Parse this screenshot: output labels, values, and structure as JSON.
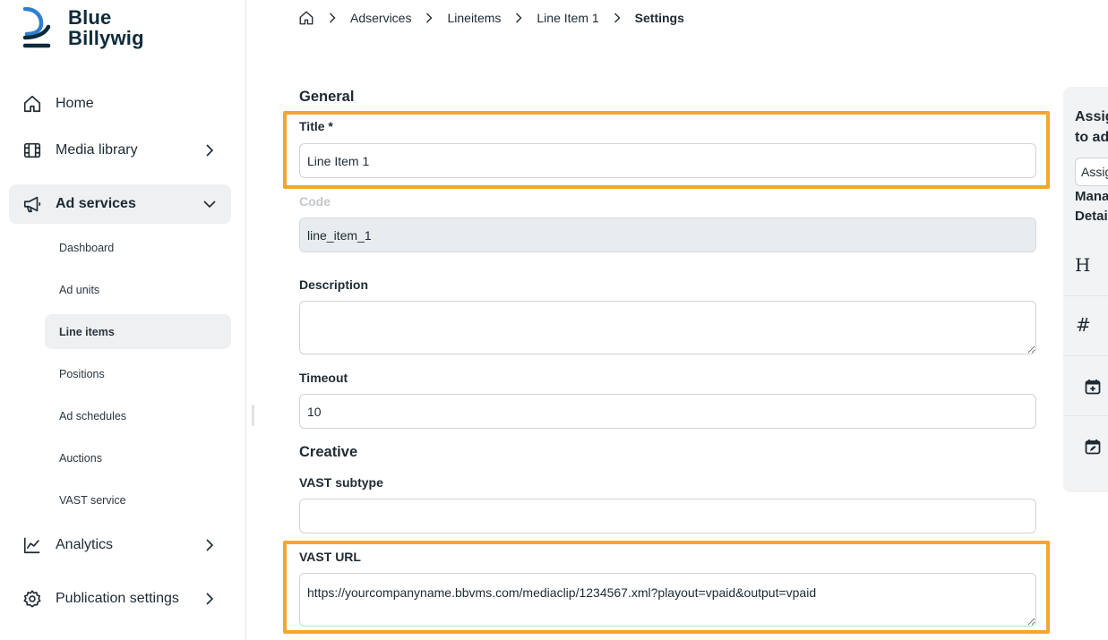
{
  "brand": {
    "line1": "Blue",
    "line2": "Billywig",
    "accent": "#0f2b3a"
  },
  "sidebar": {
    "items": [
      {
        "label": "Home",
        "icon": "home-icon"
      },
      {
        "label": "Media library",
        "icon": "film-icon"
      },
      {
        "label": "Ad services",
        "icon": "megaphone-icon"
      },
      {
        "label": "Analytics",
        "icon": "chart-line-icon"
      },
      {
        "label": "Publication settings",
        "icon": "gear-icon"
      }
    ],
    "sub_items": [
      "Dashboard",
      "Ad units",
      "Line items",
      "Positions",
      "Ad schedules",
      "Auctions",
      "VAST service"
    ],
    "active_item": "Ad services",
    "active_sub_item": "Line items"
  },
  "breadcrumb": {
    "home_icon": "home-icon",
    "items": [
      "Adservices",
      "Lineitems",
      "Line Item 1"
    ],
    "current": "Settings"
  },
  "form": {
    "general_title": "General",
    "title_label": "Title *",
    "title_value": "Line Item 1",
    "code_label": "Code",
    "code_value": "line_item_1",
    "description_label": "Description",
    "description_value": "",
    "timeout_label": "Timeout",
    "timeout_value": "10",
    "creative_title": "Creative",
    "vast_subtype_label": "VAST subtype",
    "vast_subtype_value": "",
    "vast_url_label": "VAST URL",
    "vast_url_value": "https://yourcompanyname.bbvms.com/mediaclip/1234567.xml?playout=vpaid&output=vpaid",
    "highlight_color": "#f6a531"
  },
  "right_panel": {
    "title": "Assig to ad",
    "title_line1": "Assig",
    "title_line2": "to ad",
    "select_value": "Assig",
    "sub_line1": "Manag",
    "sub_line2": "Detai",
    "icons": [
      "heading-icon",
      "hash-icon",
      "calendar-plus-icon",
      "calendar-edit-icon"
    ]
  }
}
